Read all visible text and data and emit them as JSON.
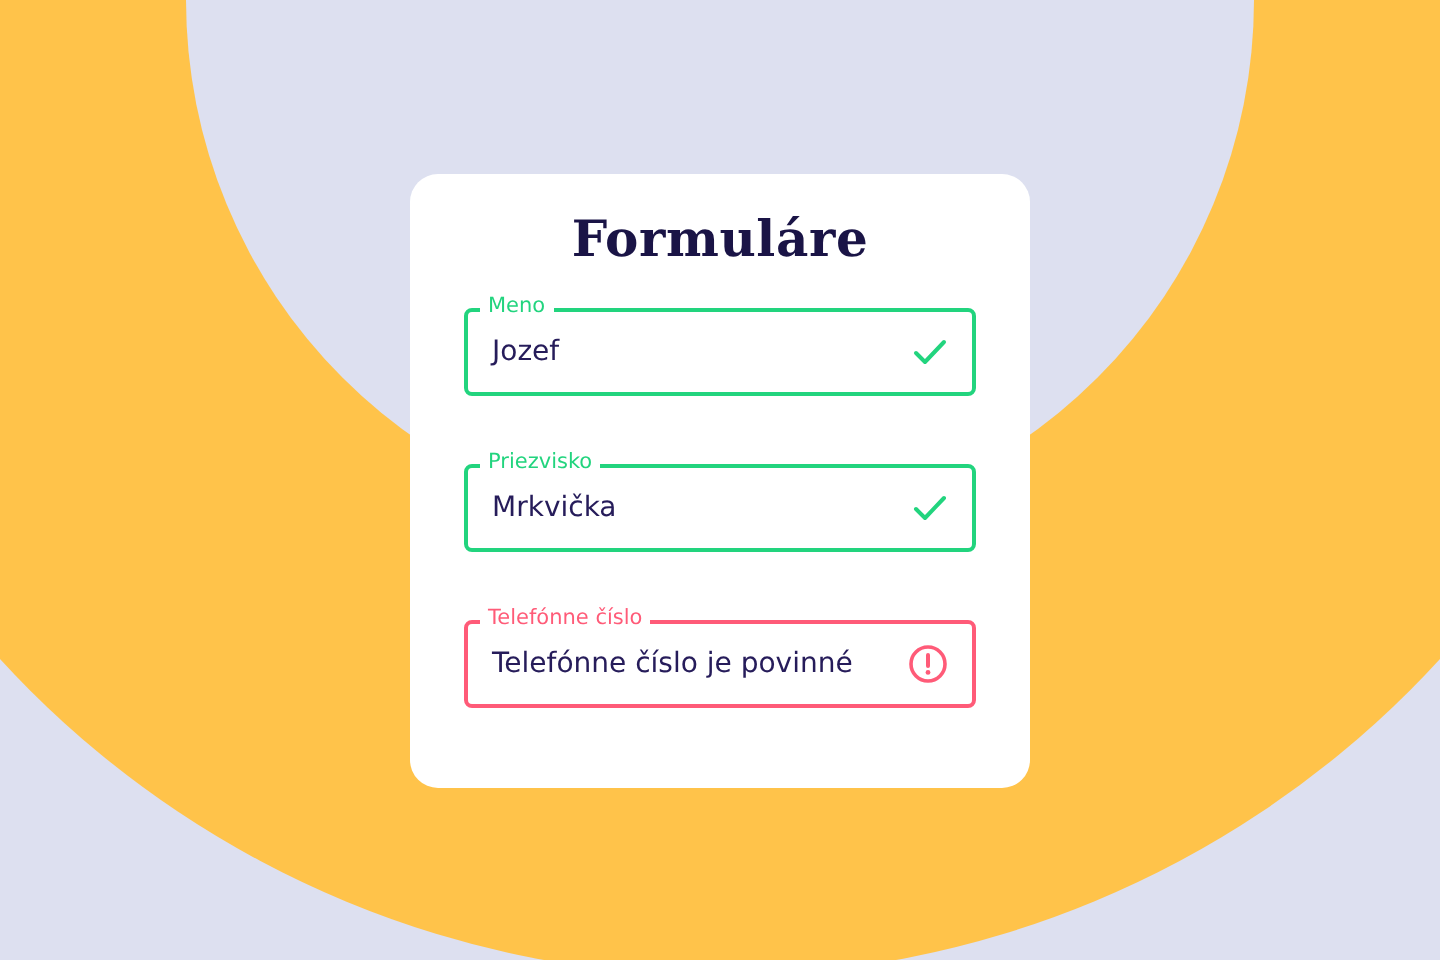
{
  "form": {
    "title": "Formuláre",
    "fields": [
      {
        "label": "Meno",
        "value": "Jozef",
        "error": false
      },
      {
        "label": "Priezvisko",
        "value": "Mrkvička",
        "error": false
      },
      {
        "label": "Telefónne číslo",
        "value": "Telefónne číslo je povinné",
        "error": true
      }
    ]
  }
}
